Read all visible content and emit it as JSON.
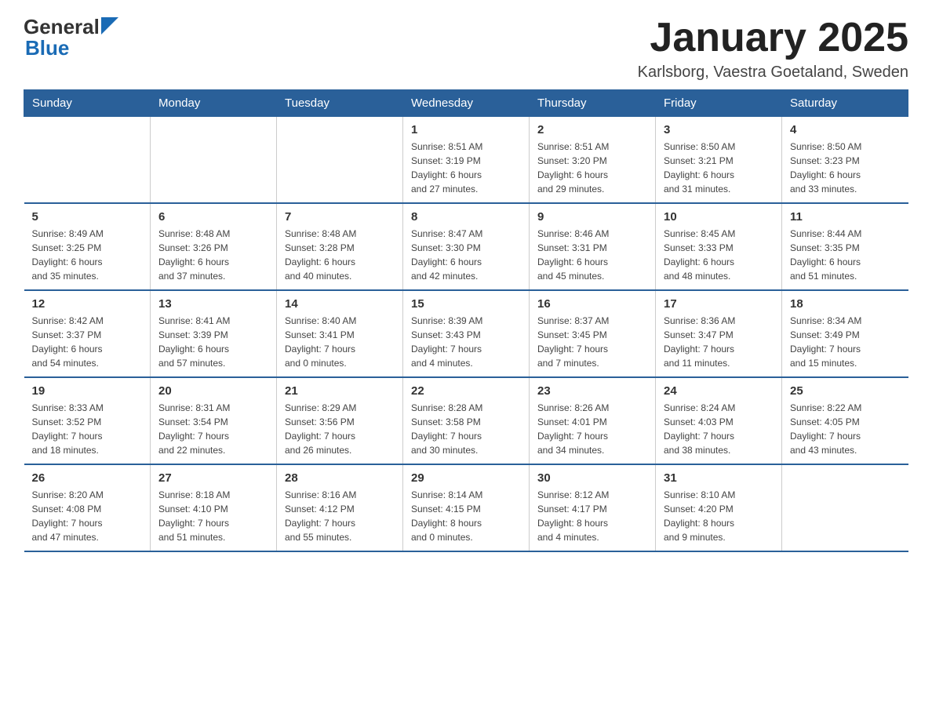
{
  "logo": {
    "text_general": "General",
    "text_blue": "Blue"
  },
  "title": "January 2025",
  "location": "Karlsborg, Vaestra Goetaland, Sweden",
  "days_of_week": [
    "Sunday",
    "Monday",
    "Tuesday",
    "Wednesday",
    "Thursday",
    "Friday",
    "Saturday"
  ],
  "weeks": [
    [
      {
        "day": "",
        "info": ""
      },
      {
        "day": "",
        "info": ""
      },
      {
        "day": "",
        "info": ""
      },
      {
        "day": "1",
        "info": "Sunrise: 8:51 AM\nSunset: 3:19 PM\nDaylight: 6 hours\nand 27 minutes."
      },
      {
        "day": "2",
        "info": "Sunrise: 8:51 AM\nSunset: 3:20 PM\nDaylight: 6 hours\nand 29 minutes."
      },
      {
        "day": "3",
        "info": "Sunrise: 8:50 AM\nSunset: 3:21 PM\nDaylight: 6 hours\nand 31 minutes."
      },
      {
        "day": "4",
        "info": "Sunrise: 8:50 AM\nSunset: 3:23 PM\nDaylight: 6 hours\nand 33 minutes."
      }
    ],
    [
      {
        "day": "5",
        "info": "Sunrise: 8:49 AM\nSunset: 3:25 PM\nDaylight: 6 hours\nand 35 minutes."
      },
      {
        "day": "6",
        "info": "Sunrise: 8:48 AM\nSunset: 3:26 PM\nDaylight: 6 hours\nand 37 minutes."
      },
      {
        "day": "7",
        "info": "Sunrise: 8:48 AM\nSunset: 3:28 PM\nDaylight: 6 hours\nand 40 minutes."
      },
      {
        "day": "8",
        "info": "Sunrise: 8:47 AM\nSunset: 3:30 PM\nDaylight: 6 hours\nand 42 minutes."
      },
      {
        "day": "9",
        "info": "Sunrise: 8:46 AM\nSunset: 3:31 PM\nDaylight: 6 hours\nand 45 minutes."
      },
      {
        "day": "10",
        "info": "Sunrise: 8:45 AM\nSunset: 3:33 PM\nDaylight: 6 hours\nand 48 minutes."
      },
      {
        "day": "11",
        "info": "Sunrise: 8:44 AM\nSunset: 3:35 PM\nDaylight: 6 hours\nand 51 minutes."
      }
    ],
    [
      {
        "day": "12",
        "info": "Sunrise: 8:42 AM\nSunset: 3:37 PM\nDaylight: 6 hours\nand 54 minutes."
      },
      {
        "day": "13",
        "info": "Sunrise: 8:41 AM\nSunset: 3:39 PM\nDaylight: 6 hours\nand 57 minutes."
      },
      {
        "day": "14",
        "info": "Sunrise: 8:40 AM\nSunset: 3:41 PM\nDaylight: 7 hours\nand 0 minutes."
      },
      {
        "day": "15",
        "info": "Sunrise: 8:39 AM\nSunset: 3:43 PM\nDaylight: 7 hours\nand 4 minutes."
      },
      {
        "day": "16",
        "info": "Sunrise: 8:37 AM\nSunset: 3:45 PM\nDaylight: 7 hours\nand 7 minutes."
      },
      {
        "day": "17",
        "info": "Sunrise: 8:36 AM\nSunset: 3:47 PM\nDaylight: 7 hours\nand 11 minutes."
      },
      {
        "day": "18",
        "info": "Sunrise: 8:34 AM\nSunset: 3:49 PM\nDaylight: 7 hours\nand 15 minutes."
      }
    ],
    [
      {
        "day": "19",
        "info": "Sunrise: 8:33 AM\nSunset: 3:52 PM\nDaylight: 7 hours\nand 18 minutes."
      },
      {
        "day": "20",
        "info": "Sunrise: 8:31 AM\nSunset: 3:54 PM\nDaylight: 7 hours\nand 22 minutes."
      },
      {
        "day": "21",
        "info": "Sunrise: 8:29 AM\nSunset: 3:56 PM\nDaylight: 7 hours\nand 26 minutes."
      },
      {
        "day": "22",
        "info": "Sunrise: 8:28 AM\nSunset: 3:58 PM\nDaylight: 7 hours\nand 30 minutes."
      },
      {
        "day": "23",
        "info": "Sunrise: 8:26 AM\nSunset: 4:01 PM\nDaylight: 7 hours\nand 34 minutes."
      },
      {
        "day": "24",
        "info": "Sunrise: 8:24 AM\nSunset: 4:03 PM\nDaylight: 7 hours\nand 38 minutes."
      },
      {
        "day": "25",
        "info": "Sunrise: 8:22 AM\nSunset: 4:05 PM\nDaylight: 7 hours\nand 43 minutes."
      }
    ],
    [
      {
        "day": "26",
        "info": "Sunrise: 8:20 AM\nSunset: 4:08 PM\nDaylight: 7 hours\nand 47 minutes."
      },
      {
        "day": "27",
        "info": "Sunrise: 8:18 AM\nSunset: 4:10 PM\nDaylight: 7 hours\nand 51 minutes."
      },
      {
        "day": "28",
        "info": "Sunrise: 8:16 AM\nSunset: 4:12 PM\nDaylight: 7 hours\nand 55 minutes."
      },
      {
        "day": "29",
        "info": "Sunrise: 8:14 AM\nSunset: 4:15 PM\nDaylight: 8 hours\nand 0 minutes."
      },
      {
        "day": "30",
        "info": "Sunrise: 8:12 AM\nSunset: 4:17 PM\nDaylight: 8 hours\nand 4 minutes."
      },
      {
        "day": "31",
        "info": "Sunrise: 8:10 AM\nSunset: 4:20 PM\nDaylight: 8 hours\nand 9 minutes."
      },
      {
        "day": "",
        "info": ""
      }
    ]
  ]
}
